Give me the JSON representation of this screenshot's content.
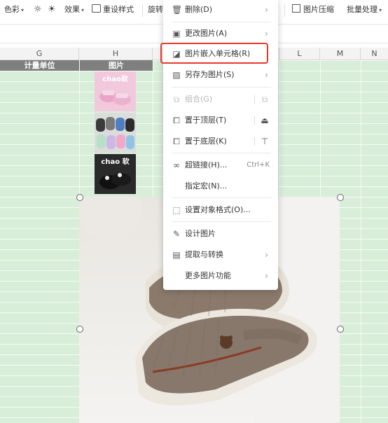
{
  "toolbar": {
    "color_label": "色彩",
    "effects_label": "效果",
    "reset_style_label": "重设样式",
    "rotate_label": "旋转",
    "compress_label": "图片压缩",
    "batch_label": "批量处理"
  },
  "columns": [
    "G",
    "H",
    "L",
    "M",
    "N"
  ],
  "sheet": {
    "header_unit": "计量单位",
    "header_image": "图片",
    "thumb1_text": "chao软",
    "thumb3_text": "chao 软"
  },
  "context_menu": {
    "items": [
      {
        "label": "删除(D)",
        "icon": "trash-icon",
        "has_submenu": true
      },
      {
        "label": "更改图片(A)",
        "icon": "change-image-icon",
        "has_submenu": true
      },
      {
        "label": "图片嵌入单元格(R)",
        "icon": "embed-cell-icon"
      },
      {
        "label": "另存为图片(S)",
        "icon": "save-image-icon",
        "has_submenu": true
      },
      {
        "label": "组合(G)",
        "icon": "group-icon",
        "disabled": true
      },
      {
        "label": "置于顶层(T)",
        "icon": "bring-front-icon"
      },
      {
        "label": "置于底层(K)",
        "icon": "send-back-icon"
      },
      {
        "label": "超链接(H)...",
        "icon": "link-icon",
        "shortcut": "Ctrl+K"
      },
      {
        "label": "指定宏(N)..."
      },
      {
        "label": "设置对象格式(O)...",
        "icon": "format-object-icon"
      },
      {
        "label": "设计图片",
        "icon": "design-image-icon"
      },
      {
        "label": "提取与转换",
        "icon": "extract-convert-icon",
        "has_submenu": true
      },
      {
        "label": "更多图片功能",
        "has_submenu": true
      }
    ]
  },
  "colors": {
    "grid_green": "#d8eed9",
    "highlight_red": "#e8382c",
    "header_gray": "#7f7f7f"
  }
}
